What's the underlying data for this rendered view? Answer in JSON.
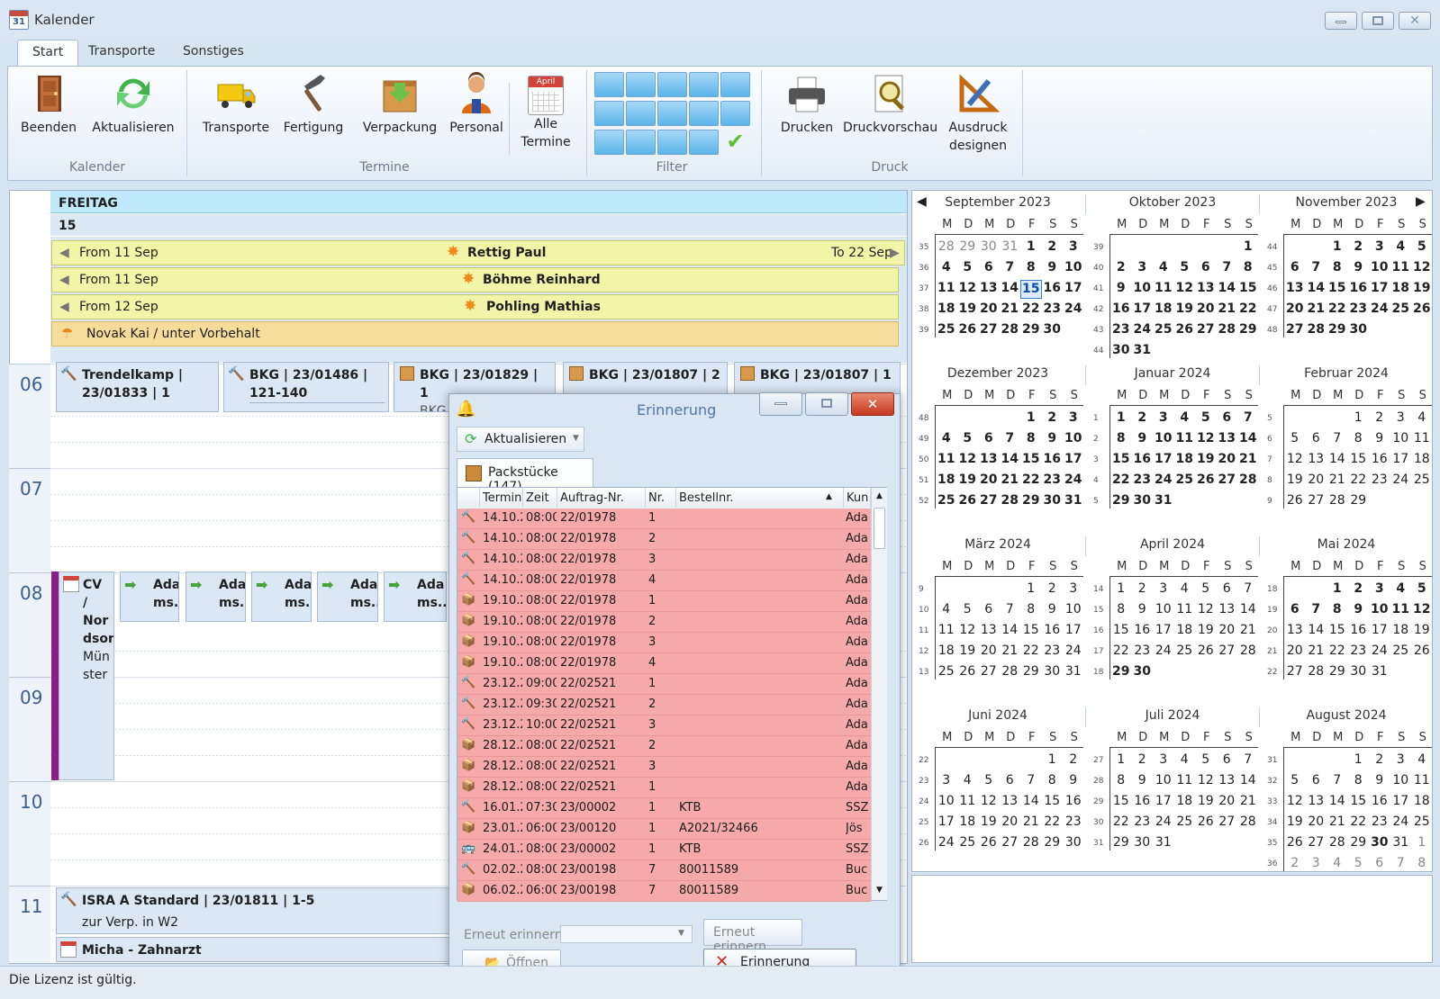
{
  "app": {
    "title": "Kalender"
  },
  "tabs": [
    "Start",
    "Transporte",
    "Sonstiges"
  ],
  "ribbon": {
    "buttons": {
      "beenden": "Beenden",
      "aktualisieren": "Aktualisieren",
      "transporte": "Transporte",
      "fertigung": "Fertigung",
      "verpackung": "Verpackung",
      "personal": "Personal",
      "alle_l1": "Alle",
      "alle_l2": "Termine",
      "alle_icon": "April",
      "drucken": "Drucken",
      "druckvorschau": "Druckvorschau",
      "ausdruck_l1": "Ausdruck",
      "ausdruck_l2": "designen"
    },
    "groups": {
      "kalender": "Kalender",
      "termine": "Termine",
      "filter": "Filter",
      "druck": "Druck"
    },
    "filter_icons": [
      "hammer-icon",
      "box-blue-icon",
      "tools-icon",
      "umbrella-icon",
      "arrow-right-icon",
      "package-icon",
      "calendar-icon",
      "gift-icon",
      "move-truck-icon",
      "truck-red-icon",
      "pliers-icon",
      "tape-icon",
      "star-person-icon",
      "truck-yellow-icon",
      "check-icon"
    ]
  },
  "day": {
    "weekday": "FREITAG",
    "date": "15",
    "allday": [
      {
        "from": "From 11 Sep",
        "name": "Rettig Paul",
        "to": "To 22 Sep"
      },
      {
        "from": "From 11 Sep",
        "name": "Böhme Reinhard"
      },
      {
        "from": "From 12 Sep",
        "name": "Pohling Mathias"
      },
      {
        "name": "Novak Kai / unter Vorbehalt"
      }
    ],
    "hours": [
      "06",
      "07",
      "08",
      "09",
      "10",
      "11"
    ],
    "appt06": [
      {
        "l1": "Trendelkamp |",
        "l2": "23/01833 | 1"
      },
      {
        "l1": "BKG | 23/01486 |",
        "l2": "121-140"
      },
      {
        "l1": "BKG | 23/01829 | 1",
        "l2": "BKG"
      },
      {
        "l1": "BKG | 23/01807 | 2"
      },
      {
        "l1": "BKG | 23/01807 | 1"
      }
    ],
    "cv": {
      "l1": "CV /",
      "l2": "Nor",
      "l3": "dson",
      "l4": "Mün",
      "l5": "ster"
    },
    "ada": {
      "l1": "Ada",
      "l2": "ms..."
    },
    "isra": {
      "l1": "ISRA A Standard | 23/01811 | 1-5",
      "l2": "zur Verp. in W2"
    },
    "micha": "Micha - Zahnarzt"
  },
  "dialog": {
    "title": "Erinnerung",
    "refresh": "Aktualisieren",
    "tab": "Packstücke (147)",
    "columns": [
      "Termin",
      "Zeit",
      "Auftrag-Nr.",
      "Nr.",
      "Bestellnr.",
      "Kun"
    ],
    "rows": [
      [
        "14.10.2",
        "08:00",
        "22/01978",
        "1",
        "",
        "Ada"
      ],
      [
        "14.10.2",
        "08:00",
        "22/01978",
        "2",
        "",
        "Ada"
      ],
      [
        "14.10.2",
        "08:00",
        "22/01978",
        "3",
        "",
        "Ada"
      ],
      [
        "14.10.2",
        "08:00",
        "22/01978",
        "4",
        "",
        "Ada"
      ],
      [
        "19.10.2",
        "08:00",
        "22/01978",
        "1",
        "",
        "Ada"
      ],
      [
        "19.10.2",
        "08:00",
        "22/01978",
        "2",
        "",
        "Ada"
      ],
      [
        "19.10.2",
        "08:00",
        "22/01978",
        "3",
        "",
        "Ada"
      ],
      [
        "19.10.2",
        "08:00",
        "22/01978",
        "4",
        "",
        "Ada"
      ],
      [
        "23.12.2",
        "09:00",
        "22/02521",
        "1",
        "",
        "Ada"
      ],
      [
        "23.12.2",
        "09:30",
        "22/02521",
        "2",
        "",
        "Ada"
      ],
      [
        "23.12.2",
        "10:00",
        "22/02521",
        "3",
        "",
        "Ada"
      ],
      [
        "28.12.2",
        "08:00",
        "22/02521",
        "2",
        "",
        "Ada"
      ],
      [
        "28.12.2",
        "08:00",
        "22/02521",
        "3",
        "",
        "Ada"
      ],
      [
        "28.12.2",
        "08:00",
        "22/02521",
        "1",
        "",
        "Ada"
      ],
      [
        "16.01.2",
        "07:30",
        "23/00002",
        "1",
        "KTB",
        "SSZ"
      ],
      [
        "23.01.2",
        "06:00",
        "23/00120",
        "1",
        "A2021/32466",
        "Jös"
      ],
      [
        "24.01.2",
        "08:00",
        "23/00002",
        "1",
        "KTB",
        "SSZ"
      ],
      [
        "02.02.2",
        "08:00",
        "23/00198",
        "7",
        "80011589",
        "Buc"
      ],
      [
        "06.02.2",
        "06:00",
        "23/00198",
        "7",
        "80011589",
        "Buc"
      ]
    ],
    "row_icons": [
      "hammer",
      "hammer",
      "hammer",
      "hammer",
      "box",
      "box",
      "box",
      "box",
      "hammer",
      "hammer",
      "hammer",
      "box",
      "box",
      "box",
      "hammer",
      "box",
      "bus",
      "hammer",
      "box"
    ],
    "remind_label": "Erneut erinnern",
    "remind_btn": "Erneut erinnern",
    "open_btn": "Öffnen",
    "delete_btn": "Erinnerung löschen"
  },
  "calendar": {
    "weekdays": [
      "M",
      "D",
      "M",
      "D",
      "F",
      "S",
      "S"
    ],
    "months": [
      {
        "title": "September 2023",
        "weeks": [
          [
            "35",
            "28",
            "29",
            "30",
            "31",
            "1",
            "2",
            "3"
          ],
          [
            "36",
            "4",
            "5",
            "6",
            "7",
            "8",
            "9",
            "10"
          ],
          [
            "37",
            "11",
            "12",
            "13",
            "14",
            "15",
            "16",
            "17"
          ],
          [
            "38",
            "18",
            "19",
            "20",
            "21",
            "22",
            "23",
            "24"
          ],
          [
            "39",
            "25",
            "26",
            "27",
            "28",
            "29",
            "30",
            ""
          ]
        ]
      },
      {
        "title": "Oktober 2023",
        "weeks": [
          [
            "39",
            "",
            "",
            "",
            "",
            "",
            "",
            "1"
          ],
          [
            "40",
            "2",
            "3",
            "4",
            "5",
            "6",
            "7",
            "8"
          ],
          [
            "41",
            "9",
            "10",
            "11",
            "12",
            "13",
            "14",
            "15"
          ],
          [
            "42",
            "16",
            "17",
            "18",
            "19",
            "20",
            "21",
            "22"
          ],
          [
            "43",
            "23",
            "24",
            "25",
            "26",
            "27",
            "28",
            "29"
          ],
          [
            "44",
            "30",
            "31",
            "",
            "",
            "",
            "",
            ""
          ]
        ]
      },
      {
        "title": "November 2023",
        "weeks": [
          [
            "44",
            "",
            "",
            "1",
            "2",
            "3",
            "4",
            "5"
          ],
          [
            "45",
            "6",
            "7",
            "8",
            "9",
            "10",
            "11",
            "12"
          ],
          [
            "46",
            "13",
            "14",
            "15",
            "16",
            "17",
            "18",
            "19"
          ],
          [
            "47",
            "20",
            "21",
            "22",
            "23",
            "24",
            "25",
            "26"
          ],
          [
            "48",
            "27",
            "28",
            "29",
            "30",
            "",
            "",
            ""
          ]
        ]
      },
      {
        "title": "Dezember 2023",
        "weeks": [
          [
            "48",
            "",
            "",
            "",
            "",
            "1",
            "2",
            "3"
          ],
          [
            "49",
            "4",
            "5",
            "6",
            "7",
            "8",
            "9",
            "10"
          ],
          [
            "50",
            "11",
            "12",
            "13",
            "14",
            "15",
            "16",
            "17"
          ],
          [
            "51",
            "18",
            "19",
            "20",
            "21",
            "22",
            "23",
            "24"
          ],
          [
            "52",
            "25",
            "26",
            "27",
            "28",
            "29",
            "30",
            "31"
          ]
        ]
      },
      {
        "title": "Januar 2024",
        "weeks": [
          [
            "1",
            "1",
            "2",
            "3",
            "4",
            "5",
            "6",
            "7"
          ],
          [
            "2",
            "8",
            "9",
            "10",
            "11",
            "12",
            "13",
            "14"
          ],
          [
            "3",
            "15",
            "16",
            "17",
            "18",
            "19",
            "20",
            "21"
          ],
          [
            "4",
            "22",
            "23",
            "24",
            "25",
            "26",
            "27",
            "28"
          ],
          [
            "5",
            "29",
            "30",
            "31",
            "",
            "",
            "",
            ""
          ]
        ]
      },
      {
        "title": "Februar 2024",
        "weeks": [
          [
            "5",
            "",
            "",
            "",
            "1",
            "2",
            "3",
            "4"
          ],
          [
            "6",
            "5",
            "6",
            "7",
            "8",
            "9",
            "10",
            "11"
          ],
          [
            "7",
            "12",
            "13",
            "14",
            "15",
            "16",
            "17",
            "18"
          ],
          [
            "8",
            "19",
            "20",
            "21",
            "22",
            "23",
            "24",
            "25"
          ],
          [
            "9",
            "26",
            "27",
            "28",
            "29",
            "",
            "",
            ""
          ]
        ]
      },
      {
        "title": "März 2024",
        "weeks": [
          [
            "9",
            "",
            "",
            "",
            "",
            "1",
            "2",
            "3"
          ],
          [
            "10",
            "4",
            "5",
            "6",
            "7",
            "8",
            "9",
            "10"
          ],
          [
            "11",
            "11",
            "12",
            "13",
            "14",
            "15",
            "16",
            "17"
          ],
          [
            "12",
            "18",
            "19",
            "20",
            "21",
            "22",
            "23",
            "24"
          ],
          [
            "13",
            "25",
            "26",
            "27",
            "28",
            "29",
            "30",
            "31"
          ]
        ]
      },
      {
        "title": "April 2024",
        "weeks": [
          [
            "14",
            "1",
            "2",
            "3",
            "4",
            "5",
            "6",
            "7"
          ],
          [
            "15",
            "8",
            "9",
            "10",
            "11",
            "12",
            "13",
            "14"
          ],
          [
            "16",
            "15",
            "16",
            "17",
            "18",
            "19",
            "20",
            "21"
          ],
          [
            "17",
            "22",
            "23",
            "24",
            "25",
            "26",
            "27",
            "28"
          ],
          [
            "18",
            "29",
            "30",
            "",
            "",
            "",
            "",
            ""
          ]
        ]
      },
      {
        "title": "Mai 2024",
        "weeks": [
          [
            "18",
            "",
            "",
            "1",
            "2",
            "3",
            "4",
            "5"
          ],
          [
            "19",
            "6",
            "7",
            "8",
            "9",
            "10",
            "11",
            "12"
          ],
          [
            "20",
            "13",
            "14",
            "15",
            "16",
            "17",
            "18",
            "19"
          ],
          [
            "21",
            "20",
            "21",
            "22",
            "23",
            "24",
            "25",
            "26"
          ],
          [
            "22",
            "27",
            "28",
            "29",
            "30",
            "31",
            "",
            ""
          ]
        ]
      },
      {
        "title": "Juni 2024",
        "weeks": [
          [
            "22",
            "",
            "",
            "",
            "",
            "",
            "1",
            "2"
          ],
          [
            "23",
            "3",
            "4",
            "5",
            "6",
            "7",
            "8",
            "9"
          ],
          [
            "24",
            "10",
            "11",
            "12",
            "13",
            "14",
            "15",
            "16"
          ],
          [
            "25",
            "17",
            "18",
            "19",
            "20",
            "21",
            "22",
            "23"
          ],
          [
            "26",
            "24",
            "25",
            "26",
            "27",
            "28",
            "29",
            "30"
          ]
        ]
      },
      {
        "title": "Juli 2024",
        "weeks": [
          [
            "27",
            "1",
            "2",
            "3",
            "4",
            "5",
            "6",
            "7"
          ],
          [
            "28",
            "8",
            "9",
            "10",
            "11",
            "12",
            "13",
            "14"
          ],
          [
            "29",
            "15",
            "16",
            "17",
            "18",
            "19",
            "20",
            "21"
          ],
          [
            "30",
            "22",
            "23",
            "24",
            "25",
            "26",
            "27",
            "28"
          ],
          [
            "31",
            "29",
            "30",
            "31",
            "",
            "",
            "",
            ""
          ]
        ]
      },
      {
        "title": "August 2024",
        "weeks": [
          [
            "31",
            "",
            "",
            "",
            "1",
            "2",
            "3",
            "4"
          ],
          [
            "32",
            "5",
            "6",
            "7",
            "8",
            "9",
            "10",
            "11"
          ],
          [
            "33",
            "12",
            "13",
            "14",
            "15",
            "16",
            "17",
            "18"
          ],
          [
            "34",
            "19",
            "20",
            "21",
            "22",
            "23",
            "24",
            "25"
          ],
          [
            "35",
            "26",
            "27",
            "28",
            "29",
            "30",
            "31",
            "1"
          ],
          [
            "36",
            "2",
            "3",
            "4",
            "5",
            "6",
            "7",
            "8"
          ]
        ]
      }
    ]
  },
  "status": {
    "text": "Die Lizenz ist gültig."
  }
}
